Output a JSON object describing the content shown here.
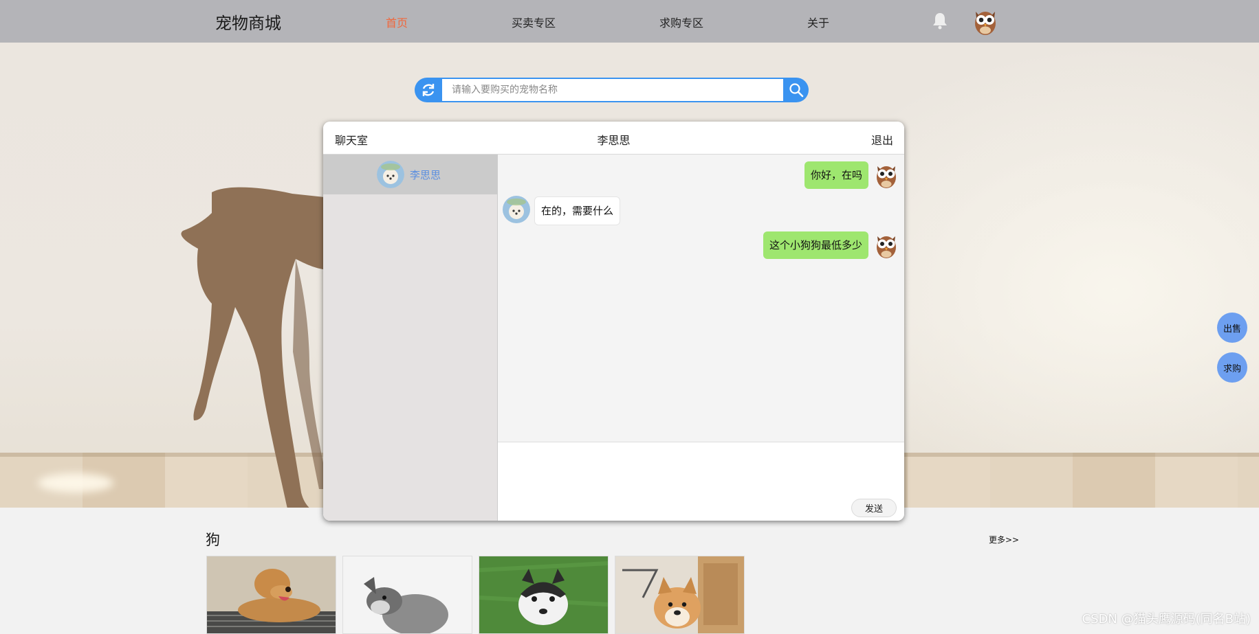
{
  "nav": {
    "brand": "宠物商城",
    "links": [
      {
        "label": "首页",
        "active": true
      },
      {
        "label": "买卖专区",
        "active": false
      },
      {
        "label": "求购专区",
        "active": false
      },
      {
        "label": "关于",
        "active": false
      }
    ],
    "icons": [
      "bell-icon",
      "owl-avatar"
    ]
  },
  "search": {
    "placeholder": "请输入要购买的宠物名称",
    "value": ""
  },
  "chat": {
    "title": "聊天室",
    "peer": "李思思",
    "exit_label": "退出",
    "contacts": [
      {
        "name": "李思思",
        "selected": true
      }
    ],
    "messages": [
      {
        "from": "me",
        "text": "你好，在吗"
      },
      {
        "from": "other",
        "text": "在的，需要什么"
      },
      {
        "from": "me",
        "text": "这个小狗狗最低多少"
      }
    ],
    "input_value": "",
    "send_label": "发送"
  },
  "side_buttons": {
    "sell": "出售",
    "buy": "求购"
  },
  "category": {
    "title": "狗",
    "more_label": "更多>>",
    "items": [
      "golden-retriever",
      "schnauzer",
      "husky-puppy",
      "shiba-inu"
    ]
  },
  "watermark": "CSDN @猫头鹰源码(同名B站)",
  "colors": {
    "nav_bg": "#b4b4b8",
    "active_link": "#f0673c",
    "accent_blue": "#3a93f0",
    "my_bubble": "#9ee66f",
    "contact_name": "#5b8fe0",
    "side_button": "#6d9ff0"
  }
}
